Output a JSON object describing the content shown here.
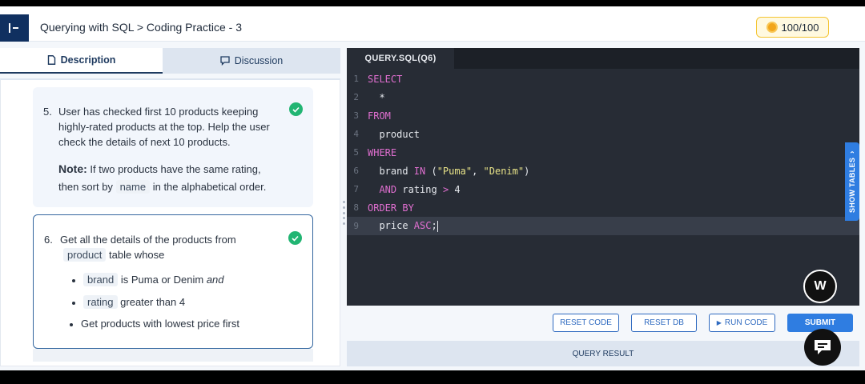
{
  "header": {
    "breadcrumb": "Querying with SQL > Coding Practice - 3",
    "score": "100/100"
  },
  "tabs": [
    {
      "label": "Description",
      "icon": "document-icon",
      "active": true
    },
    {
      "label": "Discussion",
      "icon": "chat-bubble-icon",
      "active": false
    }
  ],
  "questions": {
    "q5": {
      "number": "5.",
      "line1": "User has checked first 10 products keeping",
      "line2": "highly-rated products at the top. Help the user",
      "line3": "check the details of next 10 products.",
      "note_label": "Note:",
      "note_text": " If two products have the same rating,",
      "note_line2_pre": "then sort by",
      "note_chip": "name",
      "note_line2_post": "in the alphabetical order."
    },
    "q6": {
      "number": "6.",
      "line1": "Get all the details of the products from",
      "chip_table": "product",
      "table_whose": "table whose",
      "b1_chip": "brand",
      "b1_text": "is Puma or Denim",
      "b1_and": "and",
      "b2_chip": "rating",
      "b2_text": "greater than 4",
      "b3_text": "Get products with lowest price first"
    }
  },
  "editor": {
    "tab_label": "QUERY.SQL(Q6)",
    "lines": [
      {
        "n": "1",
        "tokens": [
          {
            "t": "SELECT",
            "c": "kw"
          }
        ]
      },
      {
        "n": "2",
        "tokens": [
          {
            "t": "  *",
            "c": ""
          }
        ]
      },
      {
        "n": "3",
        "tokens": [
          {
            "t": "FROM",
            "c": "kw"
          }
        ]
      },
      {
        "n": "4",
        "tokens": [
          {
            "t": "  product",
            "c": ""
          }
        ]
      },
      {
        "n": "5",
        "tokens": [
          {
            "t": "WHERE",
            "c": "kw"
          }
        ]
      },
      {
        "n": "6",
        "tokens": [
          {
            "t": "  brand ",
            "c": ""
          },
          {
            "t": "IN",
            "c": "kw"
          },
          {
            "t": " (",
            "c": ""
          },
          {
            "t": "\"Puma\"",
            "c": "str"
          },
          {
            "t": ", ",
            "c": ""
          },
          {
            "t": "\"Denim\"",
            "c": "str"
          },
          {
            "t": ")",
            "c": ""
          }
        ]
      },
      {
        "n": "7",
        "tokens": [
          {
            "t": "  ",
            "c": ""
          },
          {
            "t": "AND",
            "c": "kw"
          },
          {
            "t": " rating ",
            "c": ""
          },
          {
            "t": ">",
            "c": "kw"
          },
          {
            "t": " 4",
            "c": ""
          }
        ]
      },
      {
        "n": "8",
        "tokens": [
          {
            "t": "ORDER BY",
            "c": "kw"
          }
        ]
      },
      {
        "n": "9",
        "tokens": [
          {
            "t": "  price ",
            "c": ""
          },
          {
            "t": "ASC",
            "c": "kw"
          },
          {
            "t": ";",
            "c": ""
          }
        ]
      }
    ],
    "active_line": "9",
    "show_tables": "SHOW TABLES"
  },
  "buttons": {
    "reset_code": "RESET CODE",
    "reset_db": "RESET DB",
    "run_code": "RUN CODE",
    "submit": "SUBMIT"
  },
  "result_label": "QUERY RESULT",
  "badge_letter": "W",
  "colors": {
    "brand_navy": "#103060",
    "accent_blue": "#2f7de1",
    "success_green": "#22b573",
    "editor_bg": "#272c35",
    "keyword": "#e06fd0",
    "string": "#e8e388"
  }
}
